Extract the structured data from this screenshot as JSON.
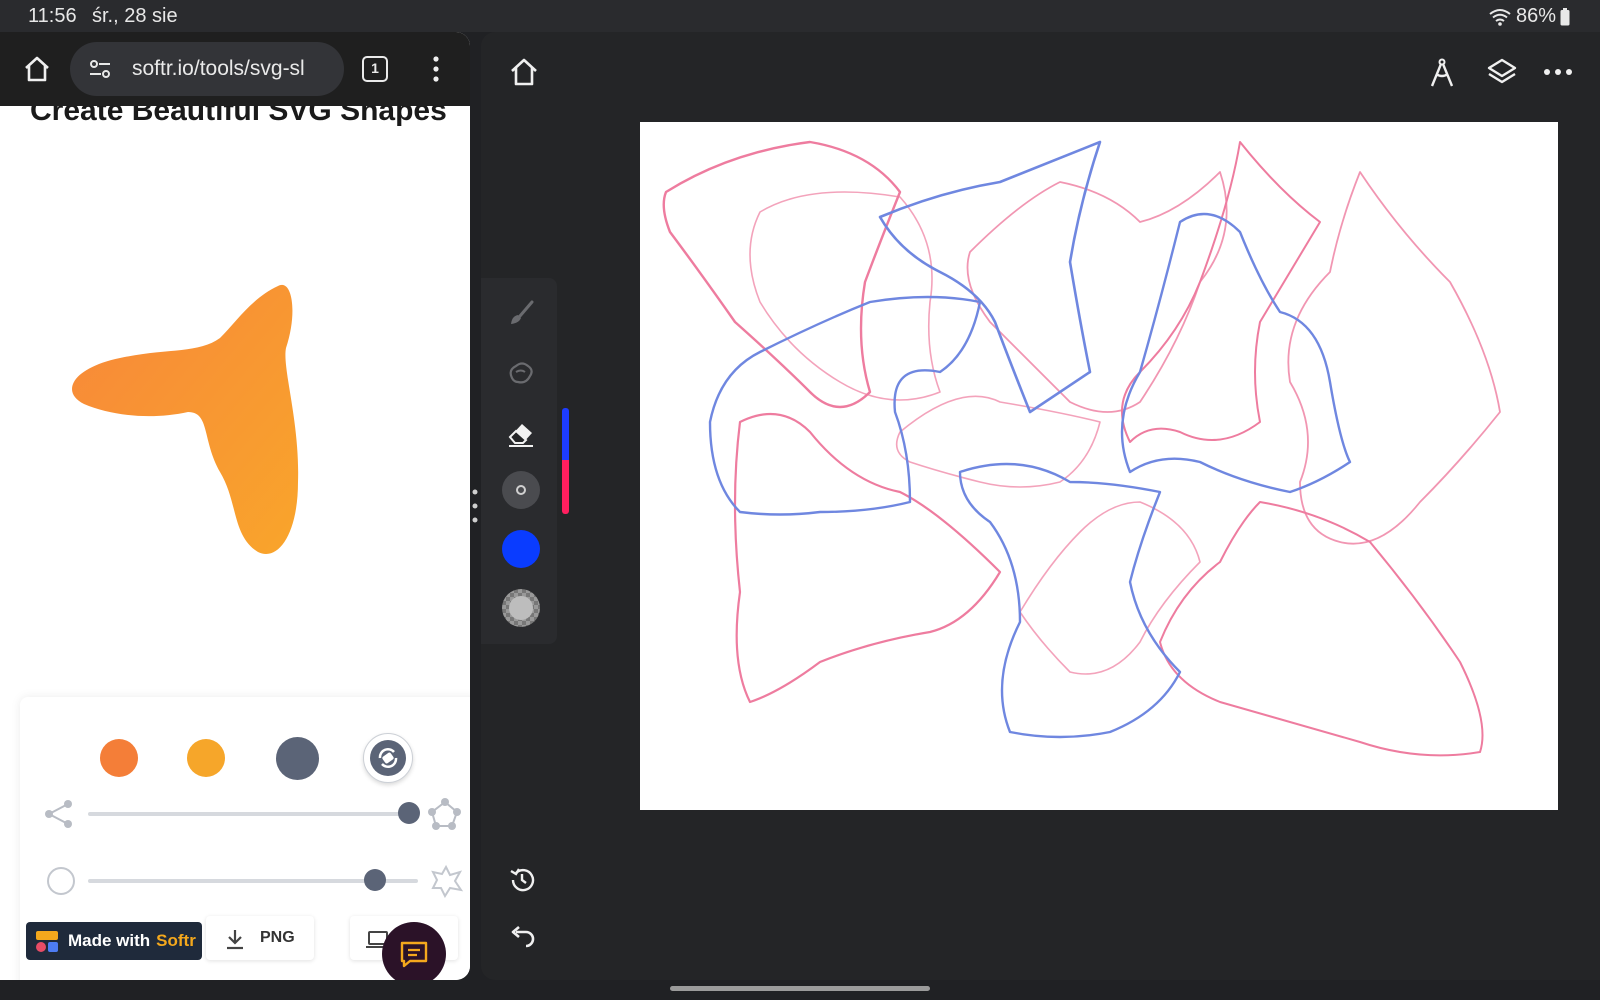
{
  "status_bar": {
    "time": "11:56",
    "date": "śr., 28 sie",
    "battery": "86%",
    "icons": [
      "wifi-icon",
      "battery-icon"
    ]
  },
  "browser": {
    "url": "softr.io/tools/svg-sl",
    "tab_count": "1",
    "page_heading": "Create Beautiful SVG Shapes",
    "shape_colors": [
      "#f47e38",
      "#f6a62a",
      "#5b6477"
    ],
    "made_with": {
      "prefix": "Made with",
      "brand": "Softr"
    },
    "png_button": "PNG"
  },
  "draw_app": {
    "active_color": "#0a3cff",
    "recent_colors": [
      "#1d3cff",
      "#ff1f5f"
    ],
    "canvas_background": "#ffffff",
    "stroke_colors": {
      "blue": "#3f5fd6",
      "pink": "#e8507f"
    }
  }
}
